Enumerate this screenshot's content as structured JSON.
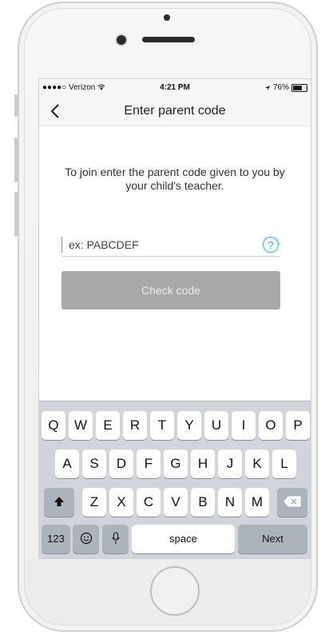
{
  "status_bar": {
    "carrier": "●●●●○ Verizon",
    "time": "4:21 PM",
    "battery": "76%",
    "battery_level": 0.76
  },
  "nav": {
    "title": "Enter parent code"
  },
  "main": {
    "instructions": "To join enter the parent code given to you by your child's teacher.",
    "code_placeholder": "ex: PABCDEF",
    "code_value": "",
    "help_glyph": "?",
    "check_button": "Check code"
  },
  "keyboard": {
    "row1": [
      "Q",
      "W",
      "E",
      "R",
      "T",
      "Y",
      "U",
      "I",
      "O",
      "P"
    ],
    "row2": [
      "A",
      "S",
      "D",
      "F",
      "G",
      "H",
      "J",
      "K",
      "L"
    ],
    "row3": [
      "Z",
      "X",
      "C",
      "V",
      "B",
      "N",
      "M"
    ],
    "numbers_key": "123",
    "space_key": "space",
    "next_key": "Next"
  },
  "icons": {
    "back": "chevron-left-icon",
    "help": "question-circle-icon",
    "shift": "shift-icon",
    "delete": "backspace-icon",
    "emoji": "emoji-icon",
    "mic": "microphone-icon",
    "wifi": "wifi-icon",
    "location": "location-arrow-icon",
    "battery": "battery-icon"
  },
  "colors": {
    "accent": "#2aa3e0",
    "button_disabled": "#a8a8a8",
    "keyboard_bg": "#d1d5db"
  }
}
